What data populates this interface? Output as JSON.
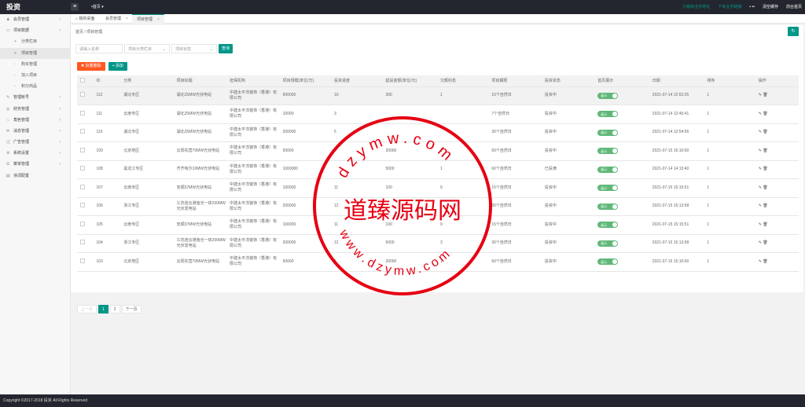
{
  "brand": "投资",
  "top_dropdown": "•首页",
  "top_right": {
    "link1": "分销商业务地址",
    "link2": "下单业务链接",
    "user": "• ••",
    "clear_cache": "清空缓存",
    "front": "前台首页"
  },
  "sidebar": {
    "items": [
      {
        "label": "会员管理",
        "icon": "user-icon"
      },
      {
        "label": "项目数据",
        "icon": "folder-icon"
      },
      {
        "label": "分类栏目",
        "icon": "plus-icon"
      },
      {
        "label": "项目管理",
        "icon": "list-icon"
      },
      {
        "label": "购买管理",
        "icon": "cart-icon"
      },
      {
        "label": "加入项目",
        "icon": "join-icon"
      },
      {
        "label": "积分商品",
        "icon": "gift-icon"
      },
      {
        "label": "管理帐号",
        "icon": "admin-icon"
      },
      {
        "label": "财务管理",
        "icon": "money-icon"
      },
      {
        "label": "角色管理",
        "icon": "role-icon"
      },
      {
        "label": "消息管理",
        "icon": "message-icon"
      },
      {
        "label": "广告管理",
        "icon": "ad-icon"
      },
      {
        "label": "系统设置",
        "icon": "gear-icon"
      },
      {
        "label": "菜单管理",
        "icon": "menu-icon"
      },
      {
        "label": "违词配置",
        "icon": "config-icon"
      }
    ]
  },
  "tabs": {
    "home": "我的桌面",
    "t1": "会员管理",
    "t2": "项目管理"
  },
  "breadcrumb": "首页 / 项目管理",
  "filters": {
    "name_placeholder": "请输入名称",
    "category_placeholder": "项目分类栏目",
    "status_placeholder": "项目状态",
    "search": "查询"
  },
  "actions": {
    "batch_delete": "批量删除",
    "add": "添加"
  },
  "table": {
    "headers": [
      "",
      "ID",
      "分类",
      "项目标题",
      "担保机构",
      "项目规模(单位/万)",
      "投资进度",
      "起投金额(单位/元)",
      "欠额利息",
      "项目期限",
      "投资状态",
      "首页展示",
      "日期",
      "排序",
      "操作"
    ],
    "rows": [
      {
        "id": "112",
        "cat": "湖北专区",
        "title": "湖北25MW光伏电站",
        "org": "中建太平洋装饰（香港）有限公司",
        "scale": "600000",
        "progress": "10",
        "min": "300",
        "interest": "1",
        "term": "15个自然日",
        "status": "投资中",
        "show": "展示",
        "date": "2021-07-14 12:52:25",
        "sort": "1"
      },
      {
        "id": "111",
        "cat": "云南专区",
        "title": "湖北25MW光伏电站",
        "org": "中建太平洋装饰（香港）有限公司",
        "scale": "10000",
        "progress": "3",
        "min": "",
        "interest": "",
        "term": "7个自然日",
        "status": "投资中",
        "show": "展示",
        "date": "2021-07-14 12:46:41",
        "sort": "1"
      },
      {
        "id": "110",
        "cat": "湖北专区",
        "title": "湖北25MW光伏电站",
        "org": "中建太平洋装饰（香港）有限公司",
        "scale": "200000",
        "progress": "5",
        "min": "",
        "interest": "",
        "term": "30个自然日",
        "status": "投资中",
        "show": "展示",
        "date": "2021-07-14 12:54:56",
        "sort": "1"
      },
      {
        "id": "109",
        "cat": "北京地区",
        "title": "云阳东营70MW光伏电站",
        "org": "中建太平洋装饰（香港）有限公司",
        "scale": "50000",
        "progress": "",
        "min": "20000",
        "interest": "1",
        "term": "60个自然日",
        "status": "投资中",
        "show": "展示",
        "date": "2021-07-15 15:10:00",
        "sort": "1"
      },
      {
        "id": "108",
        "cat": "黑龙江专区",
        "title": "齐齐哈尔10MW光伏电站",
        "org": "中建太平洋装饰（香港）有限公司",
        "scale": "1000000",
        "progress": "",
        "min": "5000",
        "interest": "1",
        "term": "60个自然日",
        "status": "已投满",
        "show": "展示",
        "date": "2021-07-14 14:13:40",
        "sort": "1"
      },
      {
        "id": "107",
        "cat": "云南专区",
        "title": "安顺37MW光伏电站",
        "org": "中建太平洋装饰（香港）有限公司",
        "scale": "100000",
        "progress": "11",
        "min": "100",
        "interest": "9",
        "term": "15个自然日",
        "status": "投资中",
        "show": "展示",
        "date": "2021-07-15 15:15:51",
        "sort": "1"
      },
      {
        "id": "106",
        "cat": "浙江专区",
        "title": "江苏连云港渔光一体200MW光伏发电站",
        "org": "中建太平洋装饰（香港）有限公司",
        "scale": "200000",
        "progress": "12",
        "min": "",
        "interest": "",
        "term": "30个自然日",
        "status": "投资中",
        "show": "展示",
        "date": "2021-07-15 15:13:58",
        "sort": "1"
      },
      {
        "id": "105",
        "cat": "云南专区",
        "title": "安顺37MW光伏电站",
        "org": "中建太平洋装饰（香港）有限公司",
        "scale": "100000",
        "progress": "11",
        "min": "100",
        "interest": "9",
        "term": "15个自然日",
        "status": "投资中",
        "show": "展示",
        "date": "2021-07-15 15:15:51",
        "sort": "1"
      },
      {
        "id": "104",
        "cat": "浙江专区",
        "title": "江苏连云港渔光一体200MW光伏发电站",
        "org": "中建太平洋装饰（香港）有限公司",
        "scale": "200000",
        "progress": "12",
        "min": "5000",
        "interest": "3",
        "term": "30个自然日",
        "status": "投资中",
        "show": "展示",
        "date": "2021-07-15 15:13:58",
        "sort": "1"
      },
      {
        "id": "103",
        "cat": "北京地区",
        "title": "云阳东营70MW光伏电站",
        "org": "中建太平洋装饰（香港）有限公司",
        "scale": "50000",
        "progress": "5",
        "min": "20000",
        "interest": "1",
        "term": "60个自然日",
        "status": "投资中",
        "show": "展示",
        "date": "2021-07-15 15:10:00",
        "sort": "1"
      }
    ]
  },
  "pager": {
    "prev": "上一页",
    "p1": "1",
    "p2": "2",
    "next": "下一页"
  },
  "footer": "Copyright ©2017-2018 投资 All Rights Reserved",
  "watermark": {
    "center": "道臻源码网",
    "ring_top": "dzymw.com",
    "ring_bottom": "www.dzymw.com",
    "color": "#e60012"
  }
}
